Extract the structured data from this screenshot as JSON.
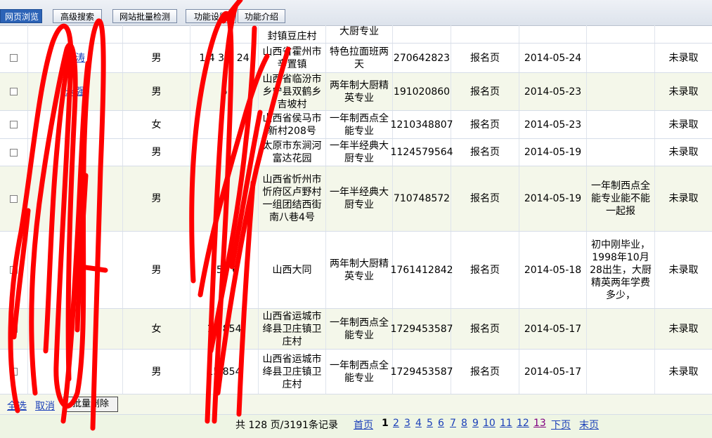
{
  "toolbar": {
    "buttons": [
      "网页浏览",
      "高级搜索",
      "网站批量检测",
      "功能设置",
      "功能介绍"
    ]
  },
  "rows": [
    {
      "name": "",
      "gender": "",
      "phone": "",
      "address": "封镇豆庄村",
      "course": "大厨专业",
      "qq": "",
      "source": "",
      "date": "",
      "note": "",
      "status": ""
    },
    {
      "name": "梁涛",
      "gender": "男",
      "phone": "1 4 3 7 24",
      "address": "山西省霍州市辛置镇",
      "course": "特色拉面班两天",
      "qq": "270642823",
      "source": "报名页",
      "date": "2014-05-24",
      "note": "",
      "status": "未录取"
    },
    {
      "name": "永强",
      "gender": "男",
      "phone": "6",
      "address": "山西省临汾市乡宁县双鹤乡吉坡村",
      "course": "两年制大厨精英专业",
      "qq": "191020860",
      "source": "报名页",
      "date": "2014-05-23",
      "note": "",
      "status": "未录取"
    },
    {
      "name": "",
      "gender": "女",
      "phone": "",
      "address": "山西省侯马市新村208号",
      "course": "一年制西点全能专业",
      "qq": "1210348807",
      "source": "报名页",
      "date": "2014-05-23",
      "note": "",
      "status": "未录取"
    },
    {
      "name": "",
      "gender": "男",
      "phone": "",
      "address": "太原市东涧河富达花园",
      "course": "一年半经典大厨专业",
      "qq": "1124579564",
      "source": "报名页",
      "date": "2014-05-19",
      "note": "",
      "status": "未录取"
    },
    {
      "name": "",
      "gender": "男",
      "phone": "",
      "address": "山西省忻州市忻府区卢野村一组团结西街南八巷4号",
      "course": "一年半经典大厨专业",
      "qq": "710748572",
      "source": "报名页",
      "date": "2014-05-19",
      "note": "一年制西点全能专业能不能一起报",
      "status": "未录取"
    },
    {
      "name": "",
      "gender": "男",
      "phone": "151 6",
      "address": "山西大同",
      "course": "两年制大厨精英专业",
      "qq": "1761412842",
      "source": "报名页",
      "date": "2014-05-18",
      "note": "初中刚毕业，1998年10月28出生，大厨精英两年学费多少，",
      "status": "未录取"
    },
    {
      "name": "",
      "gender": "女",
      "phone": "15 854",
      "address": "山西省运城市绛县卫庄镇卫庄村",
      "course": "一年制西点全能专业",
      "qq": "1729453587",
      "source": "报名页",
      "date": "2014-05-17",
      "note": "",
      "status": "未录取"
    },
    {
      "name": "",
      "gender": "男",
      "phone": "15 854",
      "address": "山西省运城市绛县卫庄镇卫庄村",
      "course": "一年制西点全能专业",
      "qq": "1729453587",
      "source": "报名页",
      "date": "2014-05-17",
      "note": "",
      "status": "未录取"
    }
  ],
  "actions": {
    "select_all": "全选",
    "cancel": "取消",
    "delete": "批量删除"
  },
  "pager": {
    "info": "共 128 页/3191条记录",
    "first": "首页",
    "current": "1",
    "pages": [
      "2",
      "3",
      "4",
      "5",
      "6",
      "7",
      "8",
      "9",
      "10",
      "11",
      "12",
      "13"
    ],
    "next": "下页",
    "last": "末页"
  }
}
